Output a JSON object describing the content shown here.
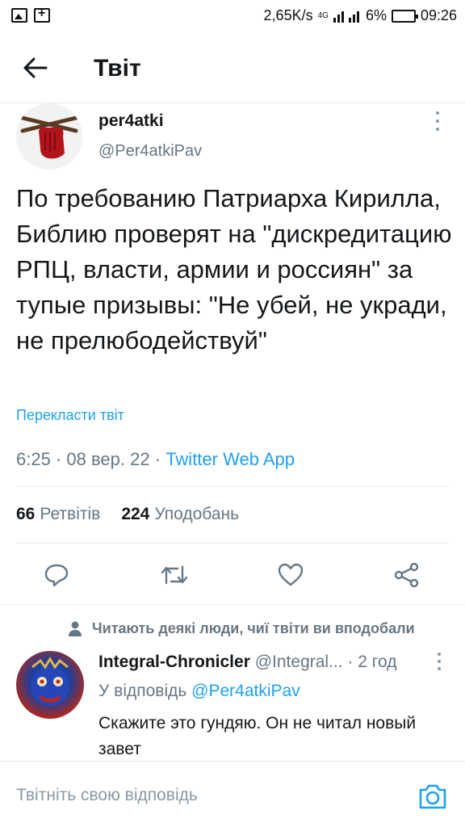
{
  "status_bar": {
    "network_speed": "2,65K/s",
    "network_type": "4G",
    "battery": "6%",
    "time": "09:26"
  },
  "header": {
    "title": "Твіт"
  },
  "tweet": {
    "author_name": "per4atki",
    "author_handle": "@Per4atkiPav",
    "text": "По требованию Патриарха Кирилла, Библию проверят на \"дискредитацию РПЦ, власти, армии и россиян\" за тупые призывы: \"Не убей, не укради, не прелюбодействуй\"",
    "translate_label": "Перекласти твіт",
    "time": "6:25",
    "date": "08 вер. 22",
    "source": "Twitter Web App",
    "retweets_count": "66",
    "retweets_label": "Ретвітів",
    "likes_count": "224",
    "likes_label": "Уподобань"
  },
  "reply_context": {
    "label": "Читають деякі люди, чиї твіти ви вподобали"
  },
  "reply": {
    "author_name": "Integral-Chronicler",
    "author_handle": "@Integral...",
    "age": "2 год",
    "reply_prefix": "У відповідь",
    "reply_mention": "@Per4atkiPav",
    "text": "Скажите это гундяю. Он не читал новый завет"
  },
  "compose": {
    "placeholder": "Твітніть свою відповідь"
  },
  "colors": {
    "accent": "#1da1f2",
    "secondary_text": "#657786",
    "primary_text": "#14171a",
    "divider": "#e6ecf0"
  },
  "icons": {
    "back": "arrow-left-icon",
    "more": "more-vertical-icon",
    "reply": "comment-icon",
    "retweet": "retweet-icon",
    "like": "heart-icon",
    "share": "share-icon",
    "person": "person-icon",
    "camera": "camera-icon"
  }
}
